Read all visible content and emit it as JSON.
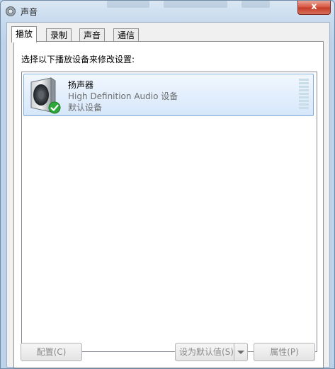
{
  "window": {
    "title": "声音",
    "close_label": "x",
    "title_icon": "speaker-icon"
  },
  "tabs": [
    {
      "label": "播放",
      "active": true
    },
    {
      "label": "录制",
      "active": false
    },
    {
      "label": "声音",
      "active": false
    },
    {
      "label": "通信",
      "active": false
    }
  ],
  "panel": {
    "instruction": "选择以下播放设备来修改设置:"
  },
  "devices": [
    {
      "name": "扬声器",
      "description": "High Definition Audio 设备",
      "status": "默认设备",
      "icon": "speaker-icon",
      "badge": "check-icon",
      "selected": true
    }
  ],
  "buttons": {
    "configure": "配置(C)",
    "set_default": "设为默认值(S)",
    "properties": "属性(P)"
  },
  "colors": {
    "selection_border": "#84acdd",
    "close_button": "#c9442e",
    "check_badge": "#2fa73a"
  }
}
